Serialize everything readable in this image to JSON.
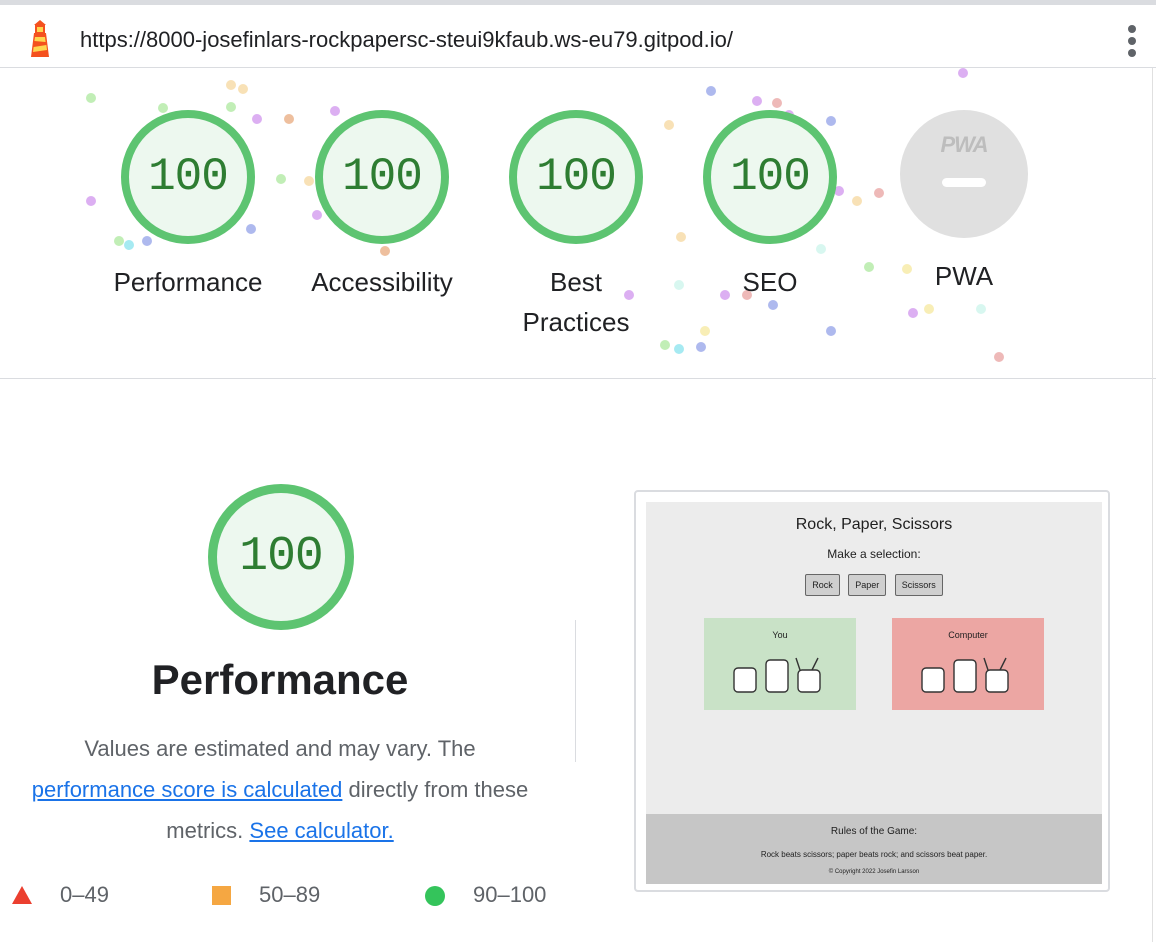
{
  "url_bar": {
    "url": "https://8000-josefinlars-rockpapersc-steui9kfaub.ws-eu79.gitpod.io/"
  },
  "summary": {
    "gauges": [
      {
        "label": "Performance",
        "score": "100"
      },
      {
        "label": "Accessibility",
        "score": "100"
      },
      {
        "label": "Best Practices",
        "score": "100"
      },
      {
        "label": "SEO",
        "score": "100"
      }
    ],
    "pwa": {
      "label": "PWA",
      "badge_text": "PWA"
    }
  },
  "performance": {
    "score": "100",
    "title": "Performance",
    "desc_part1": "Values are estimated and may vary. The ",
    "desc_link1": "performance score is calculated",
    "desc_part2": " directly from these metrics. ",
    "desc_link2": "See calculator."
  },
  "legend": {
    "fail": "0–49",
    "average": "50–89",
    "pass": "90–100"
  },
  "thumbnail": {
    "title": "Rock, Paper, Scissors",
    "subtitle": "Make a selection:",
    "buttons": [
      "Rock",
      "Paper",
      "Scissors"
    ],
    "you_label": "You",
    "computer_label": "Computer",
    "rules_title": "Rules of the Game:",
    "rules_text": "Rock beats scissors; paper beats rock; and scissors beat paper.",
    "copyright": "© Copyright 2022 Josefin Larsson"
  },
  "colors": {
    "pass": "#0cce6b",
    "average": "#ffa400",
    "fail": "#ff4e42",
    "link": "#1a73e8"
  }
}
